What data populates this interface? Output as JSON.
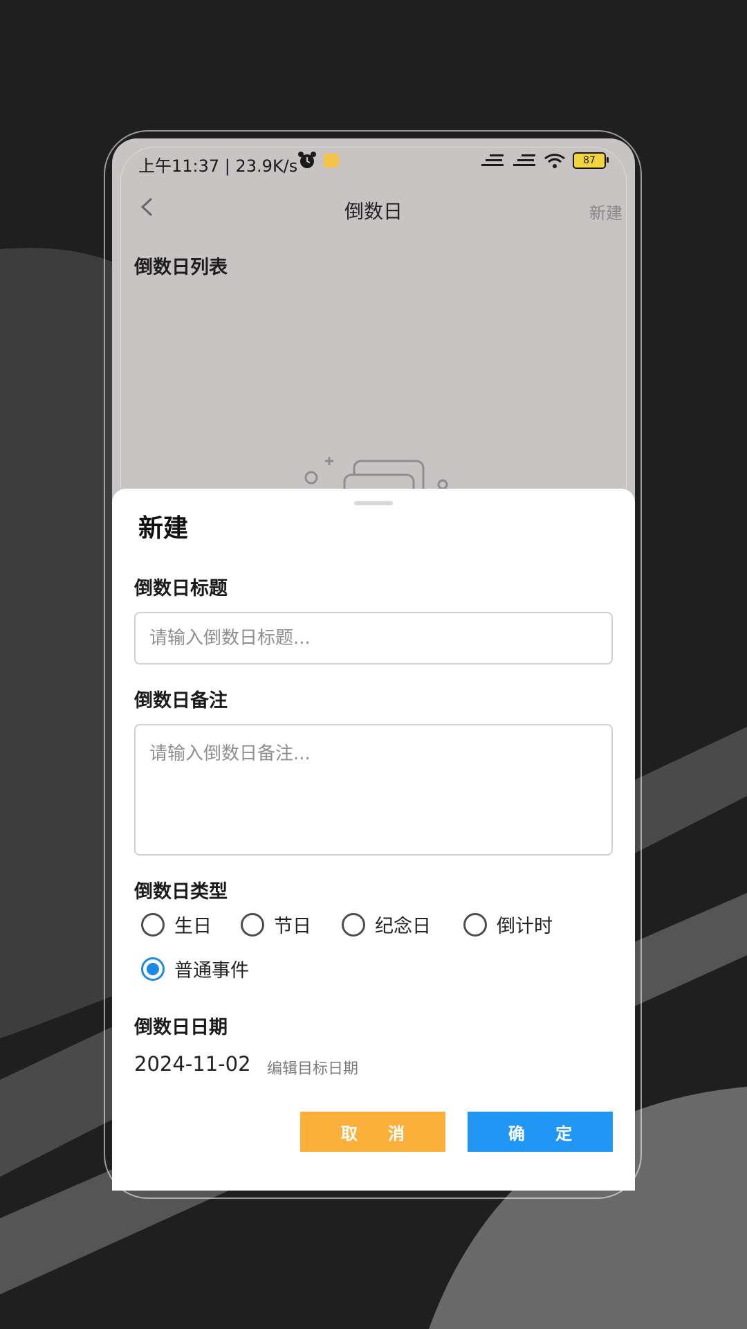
{
  "status_bar": {
    "time": "上午11:37 | 23.9K/s",
    "battery": "87"
  },
  "app_bar": {
    "title": "倒数日",
    "action": "新建"
  },
  "list": {
    "heading": "倒数日列表"
  },
  "sheet": {
    "title": "新建",
    "title_field": {
      "label": "倒数日标题",
      "placeholder": "请输入倒数日标题...",
      "value": ""
    },
    "note_field": {
      "label": "倒数日备注",
      "placeholder": "请输入倒数日备注...",
      "value": ""
    },
    "type_field": {
      "label": "倒数日类型",
      "options": [
        "生日",
        "节日",
        "纪念日",
        "倒计时",
        "普通事件"
      ],
      "selected": "普通事件"
    },
    "date_field": {
      "label": "倒数日日期",
      "value": "2024-11-02",
      "edit_label": "编辑目标日期"
    },
    "cancel_label": "取 消",
    "confirm_label": "确 定"
  },
  "colors": {
    "accent_blue": "#2196f3",
    "accent_orange": "#fbb03b",
    "dim_overlay": "#c7c4c3"
  }
}
